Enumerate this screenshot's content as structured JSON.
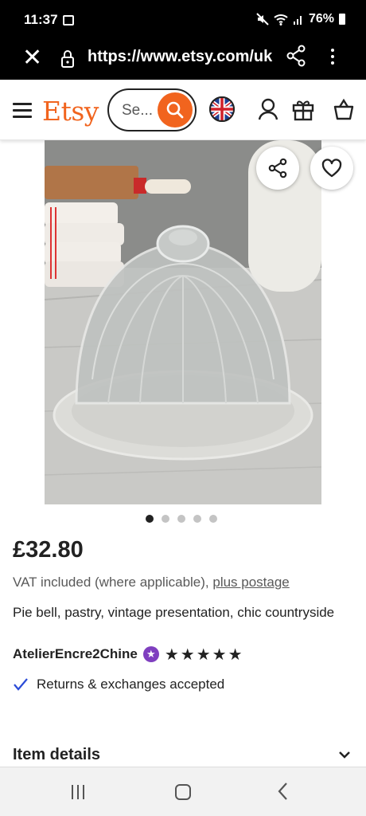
{
  "status_bar": {
    "time": "11:37",
    "battery": "76%"
  },
  "browser": {
    "url": "https://www.etsy.com/uk"
  },
  "header": {
    "logo": "Etsy",
    "search_placeholder": "Se..."
  },
  "gallery": {
    "image_count": 5,
    "active_index": 0
  },
  "listing": {
    "price": "£32.80",
    "vat_text": "VAT included (where applicable), ",
    "postage_link": "plus postage",
    "title": "Pie bell, pastry, vintage presentation, chic countryside",
    "shop_name": "AtelierEncre2Chine",
    "rating_stars": "★★★★★",
    "rating": 5,
    "returns": "Returns & exchanges accepted"
  },
  "sections": {
    "item_details": "Item details"
  },
  "colors": {
    "brand": "#f1641e",
    "star_seller": "#7f3fbf",
    "check": "#2a4bd7"
  }
}
